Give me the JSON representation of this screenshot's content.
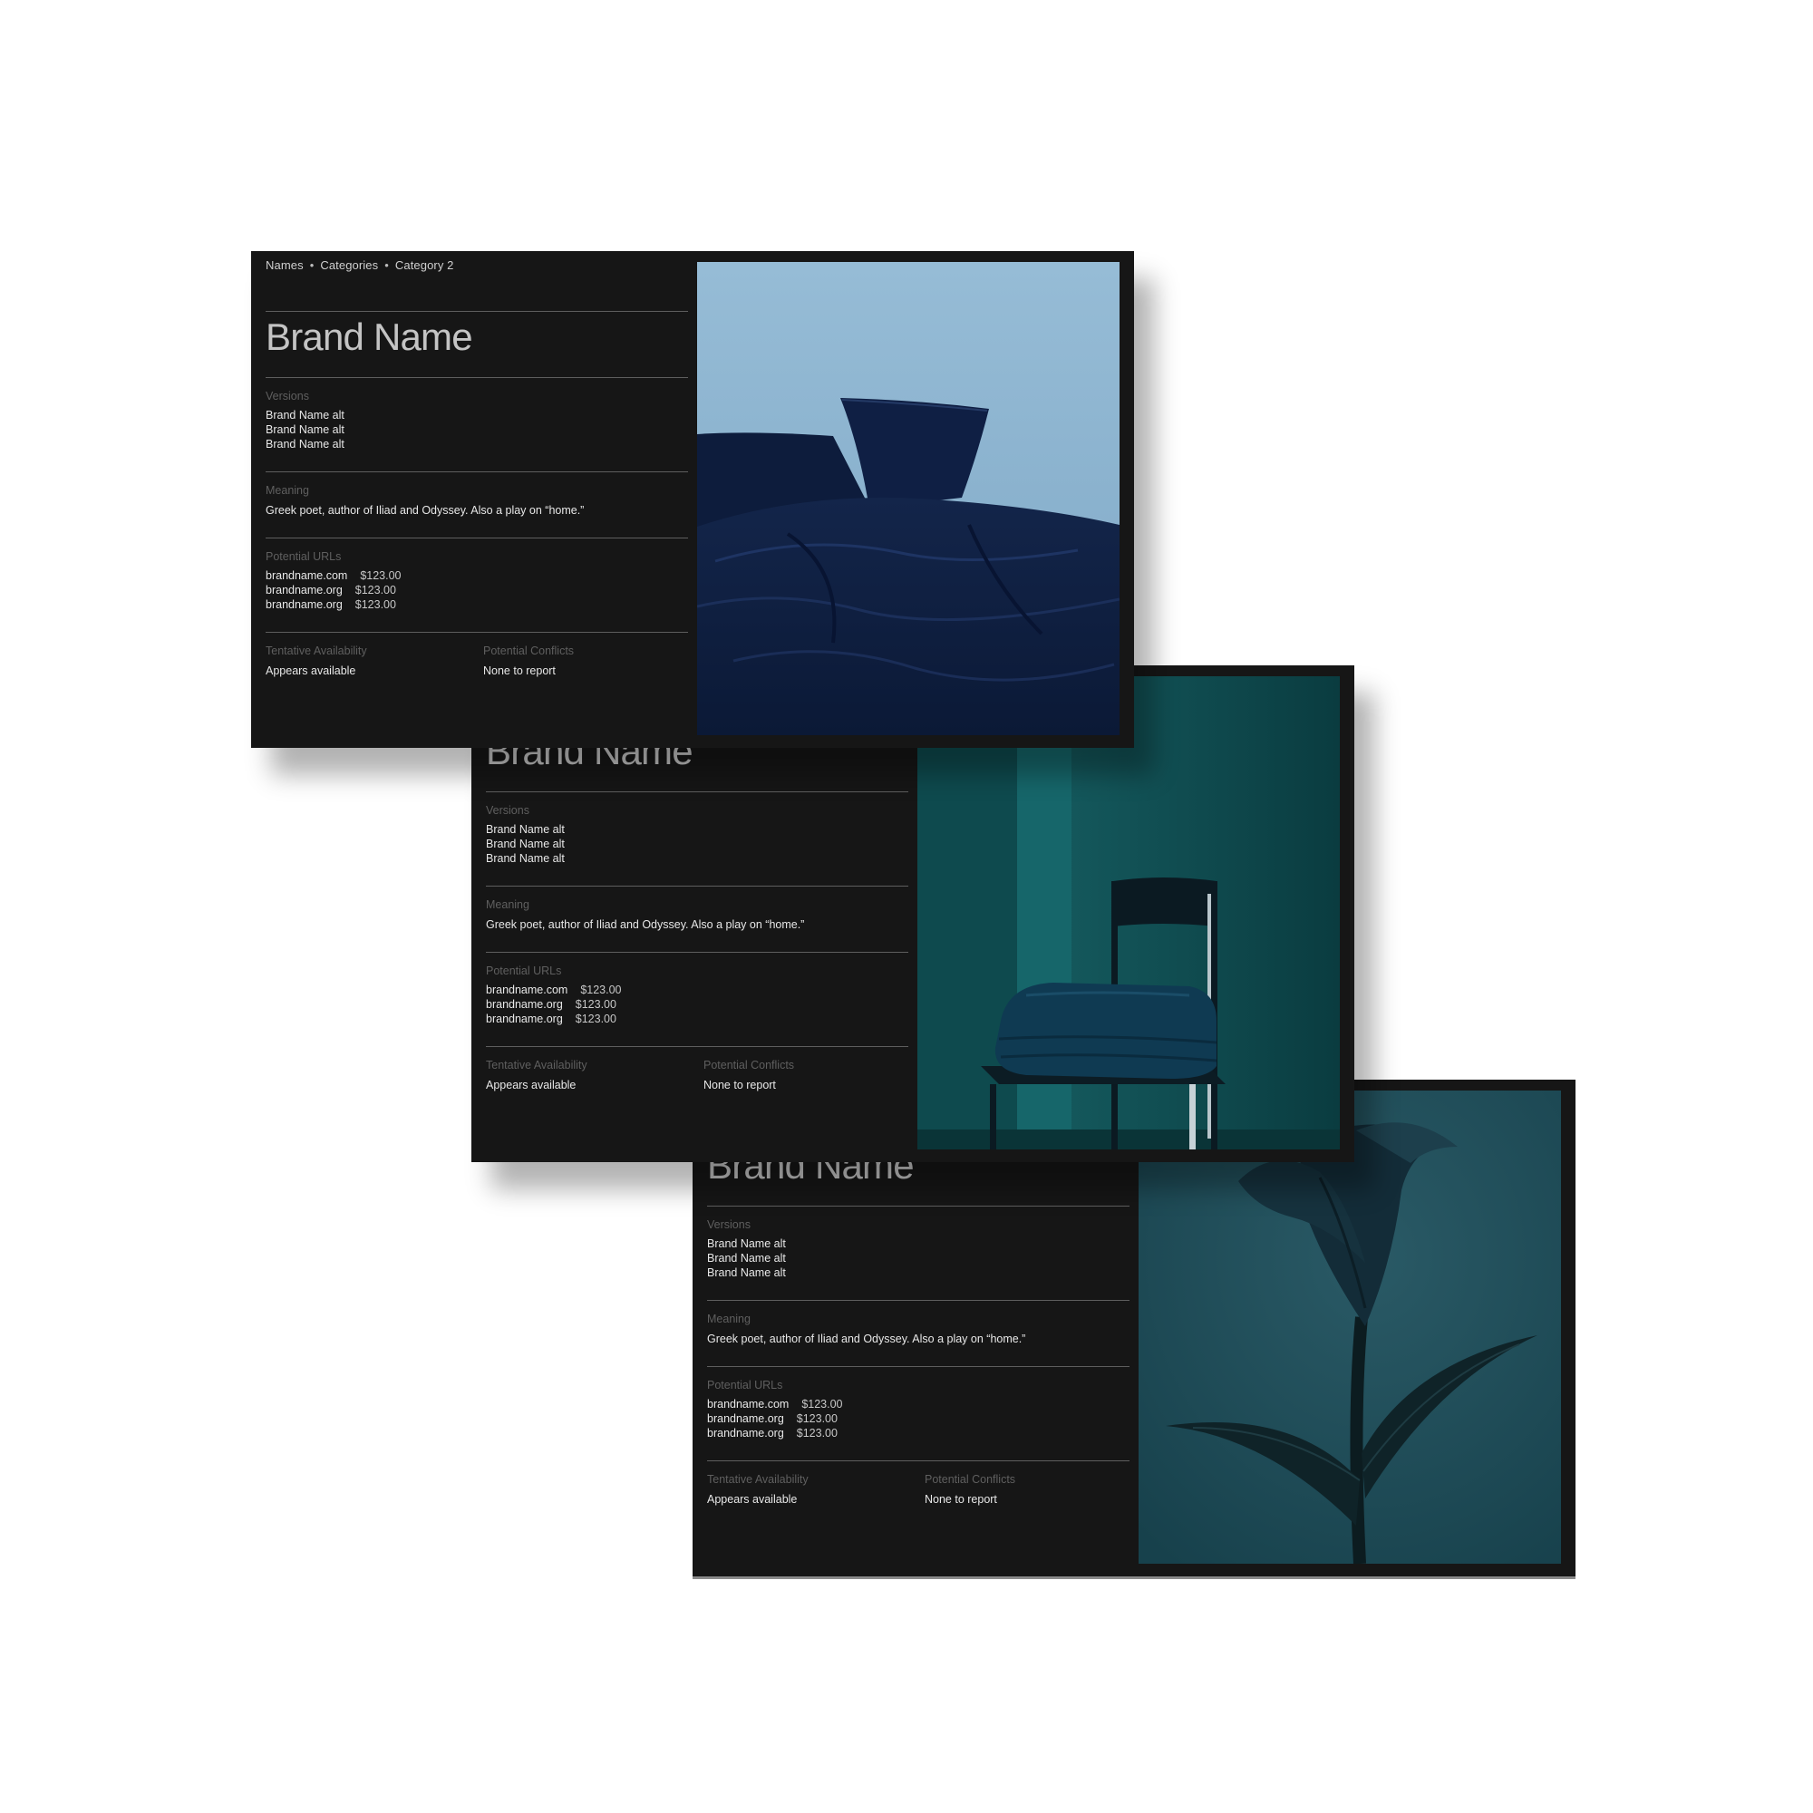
{
  "cards": [
    {
      "breadcrumb": [
        "Names",
        "Categories",
        "Category 2"
      ],
      "title": "Brand Name",
      "versions_label": "Versions",
      "versions": [
        "Brand Name alt",
        "Brand Name alt",
        "Brand Name alt"
      ],
      "meaning_label": "Meaning",
      "meaning": "Greek poet, author of Iliad and Odyssey. Also a play on “home.”",
      "urls_label": "Potential URLs",
      "urls": [
        {
          "domain": "brandname.com",
          "price": "$123.00"
        },
        {
          "domain": "brandname.org",
          "price": "$123.00"
        },
        {
          "domain": "brandname.org",
          "price": "$123.00"
        }
      ],
      "availability_label": "Tentative Availability",
      "availability": "Appears available",
      "conflicts_label": "Potential Conflicts",
      "conflicts": "None to report",
      "photo": "navy-bedding-photo"
    },
    {
      "title": "Brand Name",
      "versions_label": "Versions",
      "versions": [
        "Brand Name alt",
        "Brand Name alt",
        "Brand Name alt"
      ],
      "meaning_label": "Meaning",
      "meaning": "Greek poet, author of Iliad and Odyssey. Also a play on “home.”",
      "urls_label": "Potential URLs",
      "urls": [
        {
          "domain": "brandname.com",
          "price": "$123.00"
        },
        {
          "domain": "brandname.org",
          "price": "$123.00"
        },
        {
          "domain": "brandname.org",
          "price": "$123.00"
        }
      ],
      "availability_label": "Tentative Availability",
      "availability": "Appears available",
      "conflicts_label": "Potential Conflicts",
      "conflicts": "None to report",
      "photo": "teal-chair-photo"
    },
    {
      "title": "Brand Name",
      "versions_label": "Versions",
      "versions": [
        "Brand Name alt",
        "Brand Name alt",
        "Brand Name alt"
      ],
      "meaning_label": "Meaning",
      "meaning": "Greek poet, author of Iliad and Odyssey. Also a play on “home.”",
      "urls_label": "Potential URLs",
      "urls": [
        {
          "domain": "brandname.com",
          "price": "$123.00"
        },
        {
          "domain": "brandname.org",
          "price": "$123.00"
        },
        {
          "domain": "brandname.org",
          "price": "$123.00"
        }
      ],
      "availability_label": "Tentative Availability",
      "availability": "Appears available",
      "conflicts_label": "Potential Conflicts",
      "conflicts": "None to report",
      "photo": "calla-lily-photo"
    }
  ],
  "colors": {
    "card_background": "#161616",
    "label": "#5f5f5f",
    "value": "#e8e8e8",
    "title": "#c4c4c4",
    "rule": "#5e5e5e"
  }
}
